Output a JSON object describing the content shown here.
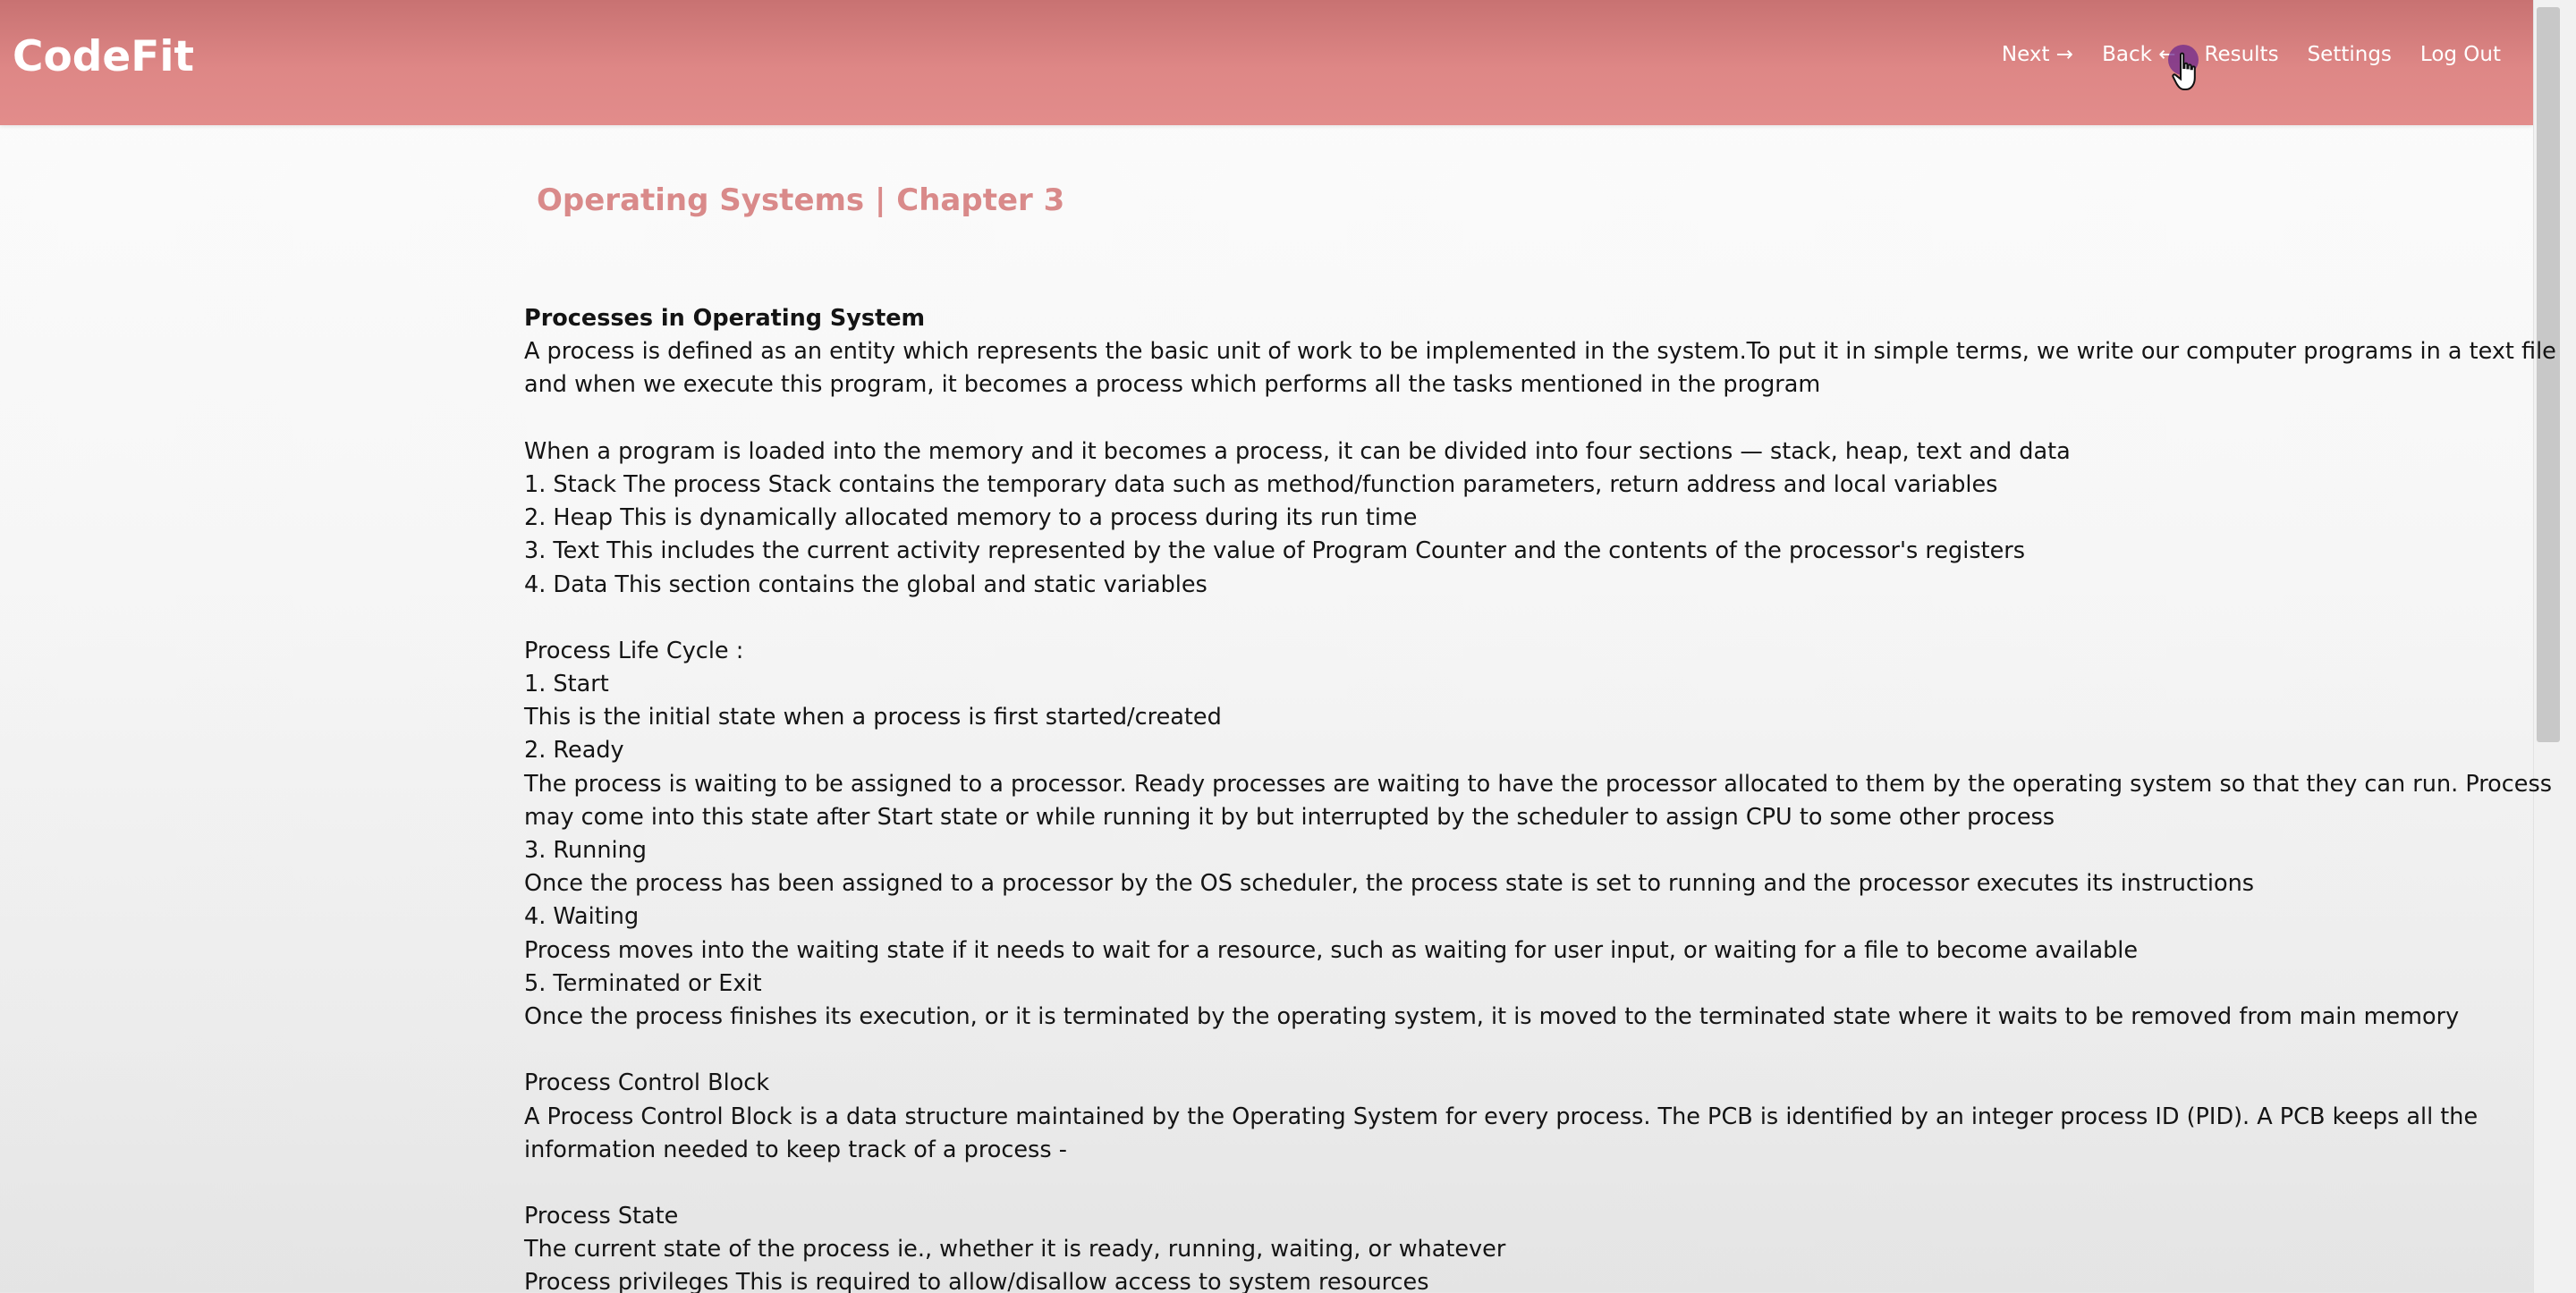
{
  "brand": "CodeFit",
  "nav": {
    "next": "Next →",
    "back": "Back ←",
    "results": "Results",
    "settings": "Settings",
    "logout": "Log Out"
  },
  "page_title": "Operating Systems | Chapter 3",
  "content": {
    "heading": "Processes in Operating System",
    "lines": [
      "A process is defined as an entity which represents the basic unit of work to be implemented in the system.To put it in simple terms, we write our computer programs in a text file",
      "and when we execute this program, it becomes a process which performs all the tasks mentioned in the program",
      "",
      "When a program is loaded into the memory and it becomes a process, it can be divided into four sections — stack, heap, text and data",
      "1. Stack The process Stack contains the temporary data such as method/function parameters, return address and local variables",
      "2. Heap This is dynamically allocated memory to a process during its run time",
      "3. Text This includes the current activity represented by the value of Program Counter and the contents of the processor's registers",
      "4. Data This section contains the global and static variables",
      "",
      "Process Life Cycle :",
      "1. Start",
      "This is the initial state when a process is first started/created",
      "2. Ready",
      "The process is waiting to be assigned to a processor. Ready processes are waiting to have the processor allocated to them by the operating system so that they can run. Process",
      "may come into this state after Start state or while running it by but interrupted by the scheduler to assign CPU to some other process",
      "3. Running",
      "Once the process has been assigned to a processor by the OS scheduler, the process state is set to running and the processor executes its instructions",
      "4. Waiting",
      "Process moves into the waiting state if it needs to wait for a resource, such as waiting for user input, or waiting for a file to become available",
      "5. Terminated or Exit",
      "Once the process finishes its execution, or it is terminated by the operating system, it is moved to the terminated state where it waits to be removed from main memory",
      "",
      "Process Control Block",
      "A Process Control Block is a data structure maintained by the Operating System for every process. The PCB is identified by an integer process ID (PID). A PCB keeps all the",
      "information needed to keep track of a process -",
      "",
      "Process State",
      "The current state of the process ie., whether it is ready, running, waiting, or whatever",
      "Process privileges This is required to allow/disallow access to system resources"
    ]
  }
}
